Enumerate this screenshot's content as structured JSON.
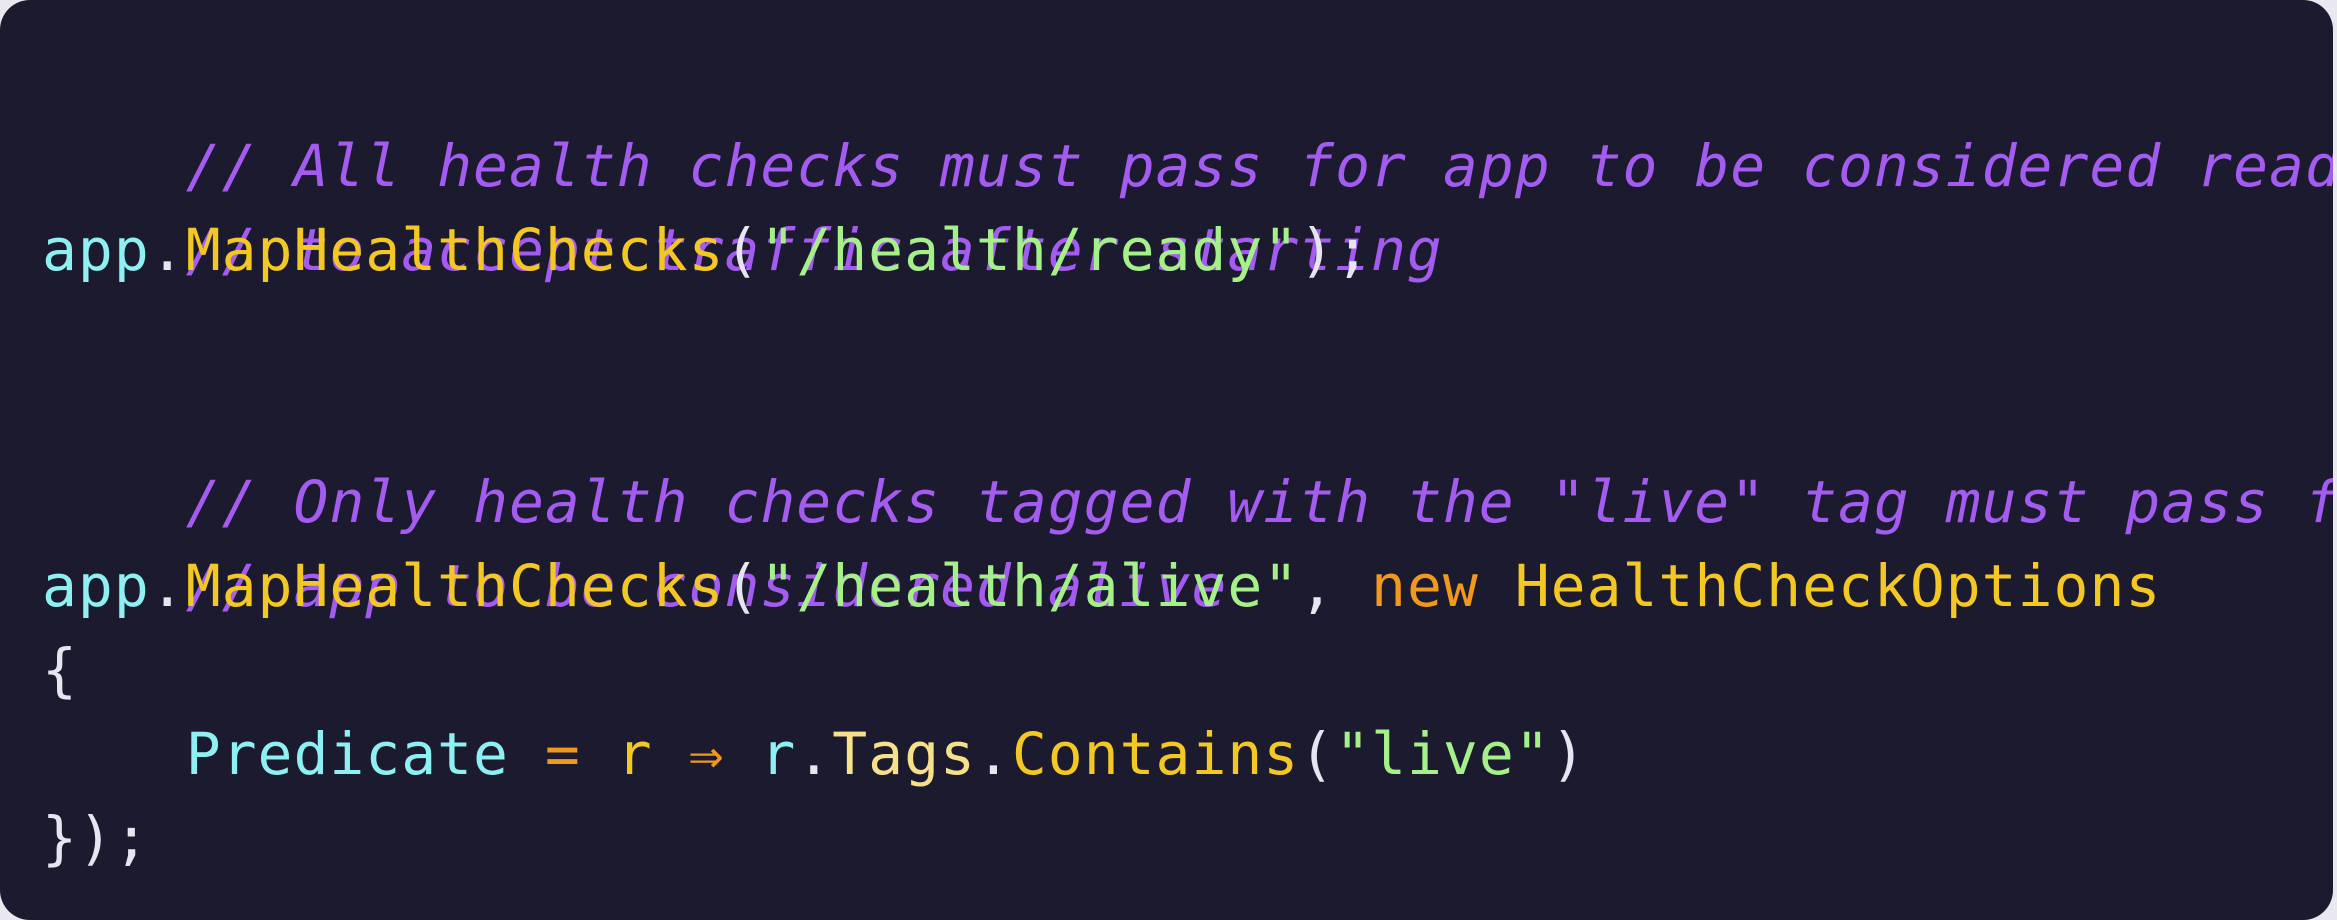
{
  "colors": {
    "background": "#1b1a2e",
    "comment": "#a35bf0",
    "identifier": "#8ef0f2",
    "method": "#f4c824",
    "string": "#a6f08a",
    "keyword": "#f0991e",
    "punctuation": "#e6e6f0"
  },
  "code": {
    "line1": "// All health checks must pass for app to be considered ready",
    "line2": "// to accept traffic after starting",
    "line3": {
      "obj": "app",
      "dot": ".",
      "method": "MapHealthChecks",
      "open": "(",
      "arg": "\"/health/ready\"",
      "close": ");"
    },
    "line5": "// Only health checks tagged with the \"live\" tag must pass for",
    "line6": "// app to be considered alive",
    "line7": {
      "obj": "app",
      "dot": ".",
      "method": "MapHealthChecks",
      "open": "(",
      "arg": "\"/health/alive\"",
      "comma": ", ",
      "keyword": "new",
      "type": "HealthCheckOptions"
    },
    "line8": "{",
    "line9": {
      "indent": "    ",
      "prop": "Predicate",
      "assign": " = ",
      "param": "r",
      "arrow": " ⇒ ",
      "obj": "r",
      "dot1": ".",
      "member": "Tags",
      "dot2": ".",
      "method": "Contains",
      "open": "(",
      "arg": "\"live\"",
      "close": ")"
    },
    "line10": "});"
  }
}
